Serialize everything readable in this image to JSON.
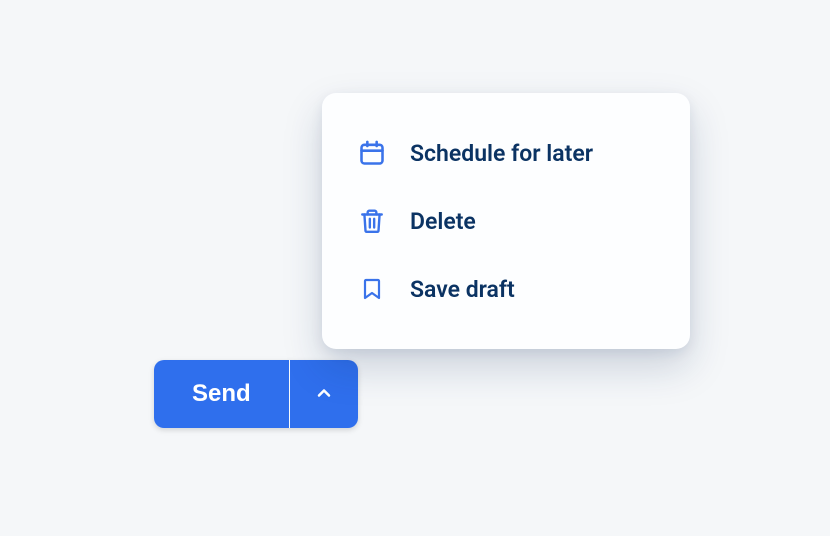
{
  "button": {
    "send_label": "Send"
  },
  "menu": {
    "items": [
      {
        "label": "Schedule for later"
      },
      {
        "label": "Delete"
      },
      {
        "label": "Save draft"
      }
    ]
  }
}
